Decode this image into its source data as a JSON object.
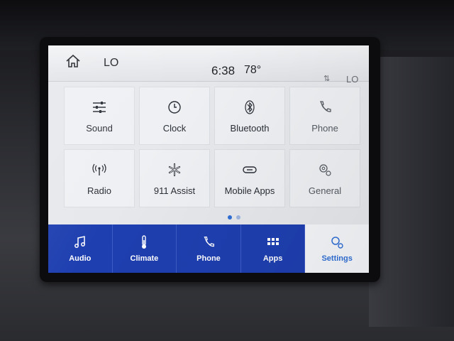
{
  "status_bar": {
    "source_left": "LO",
    "time": "6:38",
    "temperature": "78°",
    "source_right": "LO",
    "signal_icon": "signal-arrows-icon",
    "home_icon": "home-icon"
  },
  "tiles": [
    {
      "label": "Sound",
      "icon": "sliders-icon"
    },
    {
      "label": "Clock",
      "icon": "clock-icon"
    },
    {
      "label": "Bluetooth",
      "icon": "bluetooth-icon"
    },
    {
      "label": "Phone",
      "icon": "phone-icon"
    },
    {
      "label": "Radio",
      "icon": "antenna-icon"
    },
    {
      "label": "911 Assist",
      "icon": "emergency-star-icon"
    },
    {
      "label": "Mobile Apps",
      "icon": "link-icon"
    },
    {
      "label": "General",
      "icon": "gears-icon"
    }
  ],
  "page_indicator": {
    "pages": 2,
    "active": 1
  },
  "nav": [
    {
      "label": "Audio",
      "icon": "music-note-icon",
      "active": false
    },
    {
      "label": "Climate",
      "icon": "thermometer-icon",
      "active": false
    },
    {
      "label": "Phone",
      "icon": "phone-icon",
      "active": false
    },
    {
      "label": "Apps",
      "icon": "apps-grid-icon",
      "active": false
    },
    {
      "label": "Settings",
      "icon": "settings-gears-icon",
      "active": true
    }
  ],
  "colors": {
    "nav_bg": "#1e3fb0",
    "accent": "#2f6fd6",
    "screen_bg": "#e6e8ec"
  }
}
